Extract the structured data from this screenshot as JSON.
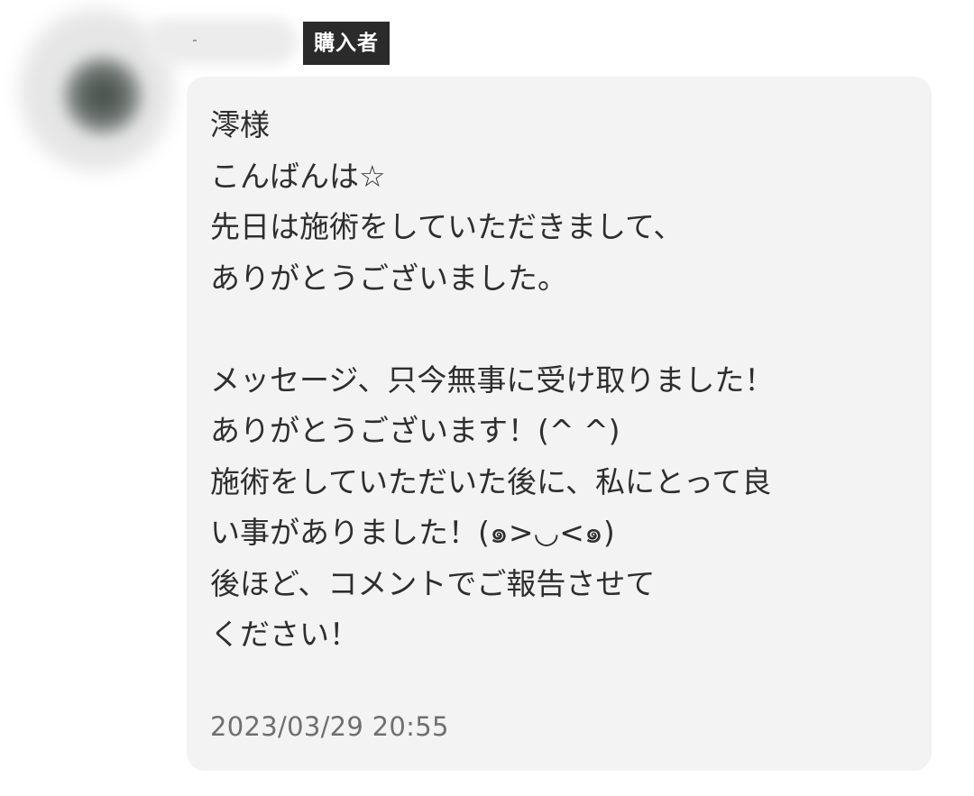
{
  "reviewer": {
    "badge_label": "購入者"
  },
  "message": {
    "lines": [
      "澪様",
      "こんばんは☆",
      "先日は施術をしていただきまして、",
      "ありがとうございました。",
      "",
      "メッセージ、只今無事に受け取りました！",
      "ありがとうございます！(^ ^)",
      "施術をしていただいた後に、私にとって良",
      "い事がありました！(๑>◡<๑)",
      "後ほど、コメントでご報告させて",
      "ください！"
    ],
    "timestamp": "2023/03/29 20:55"
  }
}
